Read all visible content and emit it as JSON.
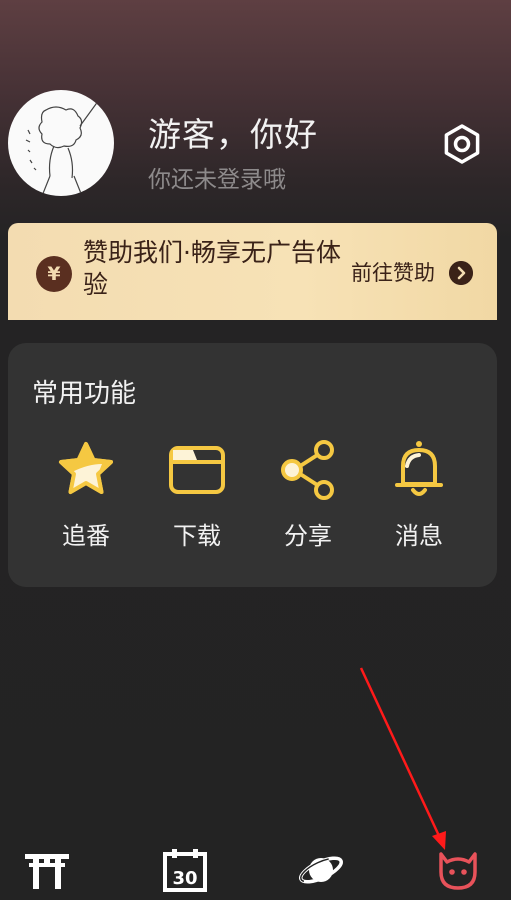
{
  "profile": {
    "greeting": "游客，你好",
    "subtitle": "你还未登录哦"
  },
  "sponsor": {
    "currency_symbol": "¥",
    "text": "赞助我们·畅享无广告体验",
    "link_label": "前往赞助"
  },
  "functions": {
    "title": "常用功能",
    "items": [
      {
        "label": "追番",
        "icon": "star-icon"
      },
      {
        "label": "下载",
        "icon": "folder-icon"
      },
      {
        "label": "分享",
        "icon": "share-icon"
      },
      {
        "label": "消息",
        "icon": "bell-icon"
      }
    ]
  },
  "bottom_nav": {
    "items": [
      {
        "icon": "torii-gate-icon",
        "active": false
      },
      {
        "icon": "calendar-icon",
        "label": "30",
        "active": false
      },
      {
        "icon": "planet-icon",
        "active": false
      },
      {
        "icon": "mascot-icon",
        "active": true
      }
    ]
  },
  "colors": {
    "accent_yellow": "#f5c842",
    "active_tab": "#e8525a",
    "annotation_arrow": "#ff1a1a"
  }
}
